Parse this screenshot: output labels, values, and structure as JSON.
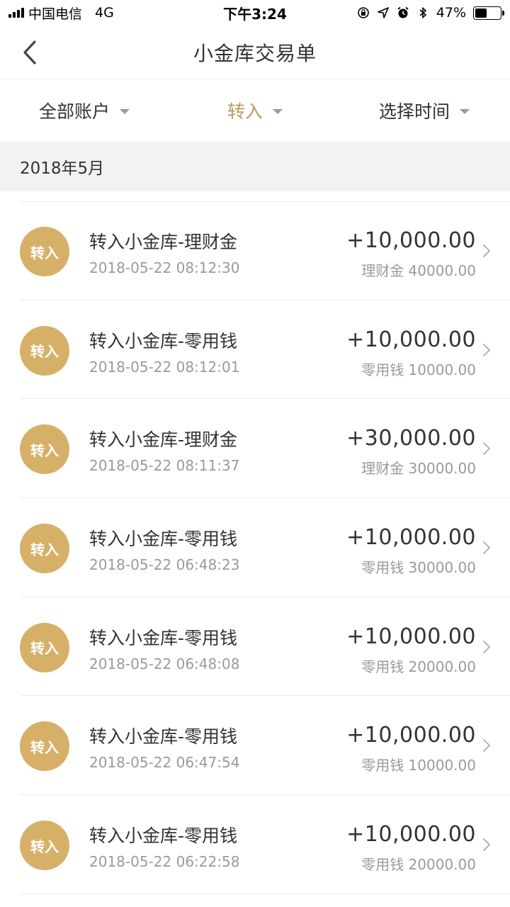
{
  "status_bar": {
    "carrier": "中国电信",
    "network": "4G",
    "time": "下午3:24",
    "battery": "47%",
    "battery_level": 0.47,
    "icons": [
      "signal-icon",
      "rotation-lock-icon",
      "location-arrow-icon",
      "alarm-icon",
      "bluetooth-icon",
      "battery-icon"
    ]
  },
  "nav": {
    "title": "小金库交易单",
    "back_icon": "chevron-left-icon"
  },
  "filters": {
    "account": "全部账户",
    "type": "转入",
    "time": "选择时间",
    "active_color": "#b89a5e"
  },
  "month": "2018年5月",
  "transactions": [
    {
      "badge": "转入",
      "title": "转入小金库-理财金",
      "time": "2018-05-22  08:12:30",
      "amount": "+10,000.00",
      "balance": "理财金 40000.00"
    },
    {
      "badge": "转入",
      "title": "转入小金库-零用钱",
      "time": "2018-05-22  08:12:01",
      "amount": "+10,000.00",
      "balance": "零用钱 10000.00"
    },
    {
      "badge": "转入",
      "title": "转入小金库-理财金",
      "time": "2018-05-22  08:11:37",
      "amount": "+30,000.00",
      "balance": "理财金 30000.00"
    },
    {
      "badge": "转入",
      "title": "转入小金库-零用钱",
      "time": "2018-05-22  06:48:23",
      "amount": "+10,000.00",
      "balance": "零用钱 30000.00"
    },
    {
      "badge": "转入",
      "title": "转入小金库-零用钱",
      "time": "2018-05-22  06:48:08",
      "amount": "+10,000.00",
      "balance": "零用钱 20000.00"
    },
    {
      "badge": "转入",
      "title": "转入小金库-零用钱",
      "time": "2018-05-22  06:47:54",
      "amount": "+10,000.00",
      "balance": "零用钱 10000.00"
    },
    {
      "badge": "转入",
      "title": "转入小金库-零用钱",
      "time": "2018-05-22  06:22:58",
      "amount": "+10,000.00",
      "balance": "零用钱 20000.00"
    }
  ],
  "colors": {
    "badge": "#d7b068",
    "accent": "#b89a5e"
  }
}
